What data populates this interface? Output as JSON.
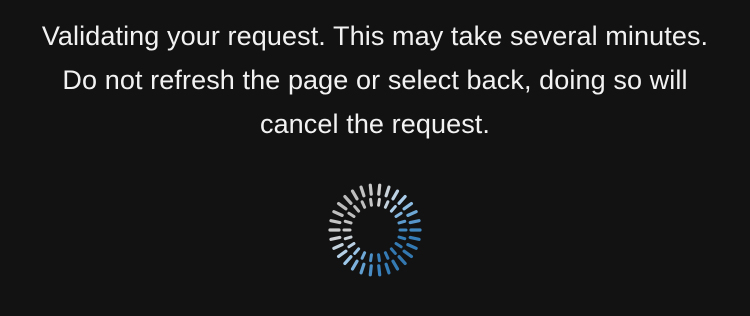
{
  "message": {
    "line1": "Validating your request. This may take several minutes.",
    "line2": "Do not refresh the page or select back, doing so will",
    "line3": "cancel the request."
  },
  "spinner": {
    "icon": "loading-spinner-icon",
    "color_light": "#f4f4f4",
    "color_accent": "#3f9be6"
  },
  "colors": {
    "background": "#121212",
    "text": "#f2f2f2"
  }
}
